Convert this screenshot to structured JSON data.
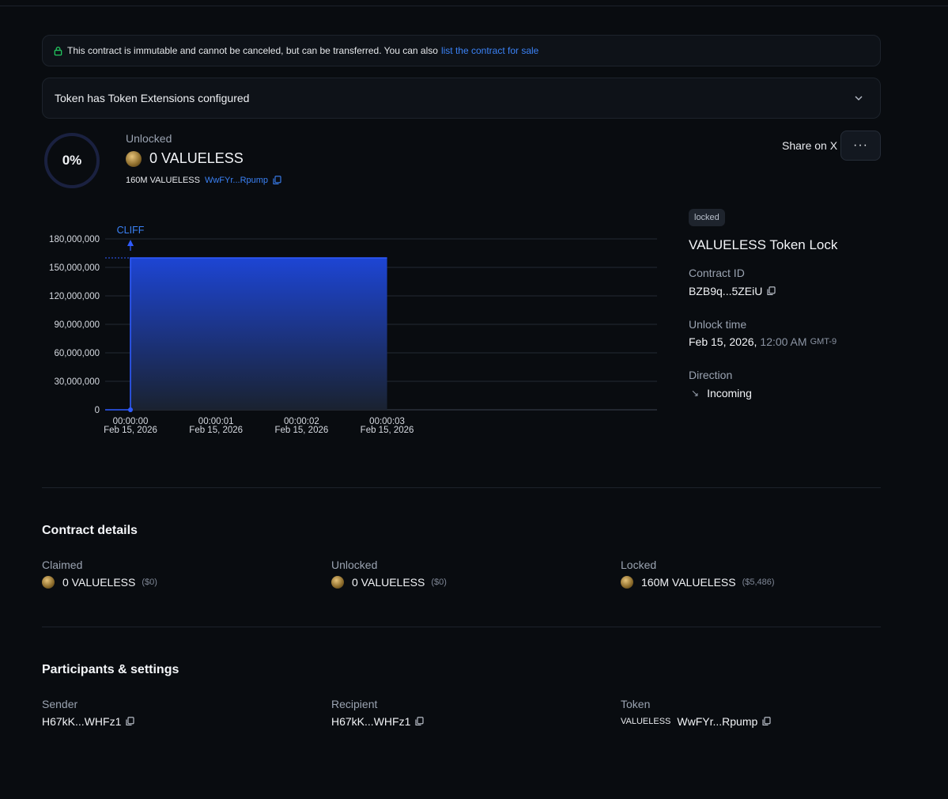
{
  "notice": {
    "text": "This contract is immutable and cannot be canceled, but can be transferred. You can also",
    "link": "list the contract for sale"
  },
  "extensions": {
    "label": "Token has Token Extensions configured"
  },
  "summary": {
    "percent": "0%",
    "percent_value": 0,
    "unlocked_label": "Unlocked",
    "unlocked_amount": "0 VALUELESS",
    "total": "160M VALUELESS",
    "token_address": "WwFYr...Rpump"
  },
  "actions": {
    "share": "Share on X",
    "more": "···"
  },
  "chart_data": {
    "type": "area",
    "annotation": "CLIFF",
    "x_ticks": [
      {
        "time": "00:00:00",
        "date": "Feb 15, 2026"
      },
      {
        "time": "00:00:01",
        "date": "Feb 15, 2026"
      },
      {
        "time": "00:00:02",
        "date": "Feb 15, 2026"
      },
      {
        "time": "00:00:03",
        "date": "Feb 15, 2026"
      }
    ],
    "y_ticks": [
      "180,000,000",
      "150,000,000",
      "120,000,000",
      "90,000,000",
      "60,000,000",
      "30,000,000",
      "0"
    ],
    "ylim": [
      0,
      180000000
    ],
    "xlim_seconds": [
      0,
      6
    ],
    "series": [
      {
        "points": [
          [
            -0.3,
            0
          ],
          [
            0,
            0
          ],
          [
            0,
            160000000
          ],
          [
            3,
            160000000
          ]
        ]
      }
    ],
    "cliff_x": 0,
    "grid": true,
    "colors": {
      "fill_top": "#1d45d4",
      "fill_bottom": "#1a2230",
      "line": "#2f5bff"
    }
  },
  "contract": {
    "status_badge": "locked",
    "title": "VALUELESS Token Lock",
    "id_label": "Contract ID",
    "id_value": "BZB9q...5ZEiU",
    "unlock_label": "Unlock time",
    "unlock_date": "Feb 15, 2026,",
    "unlock_time": "12:00 AM",
    "unlock_tz": "GMT-9",
    "direction_label": "Direction",
    "direction_icon": "↘",
    "direction_value": "Incoming"
  },
  "details": {
    "title": "Contract details",
    "claimed_label": "Claimed",
    "claimed_value": "0 VALUELESS",
    "claimed_usd": "($0)",
    "unlocked_label": "Unlocked",
    "unlocked_value": "0 VALUELESS",
    "unlocked_usd": "($0)",
    "locked_label": "Locked",
    "locked_value": "160M VALUELESS",
    "locked_usd": "($5,486)"
  },
  "participants": {
    "title": "Participants & settings",
    "sender_label": "Sender",
    "sender_value": "H67kK...WHFz1",
    "recipient_label": "Recipient",
    "recipient_value": "H67kK...WHFz1",
    "token_label": "Token",
    "token_symbol": "VALUELESS",
    "token_value": "WwFYr...Rpump"
  }
}
